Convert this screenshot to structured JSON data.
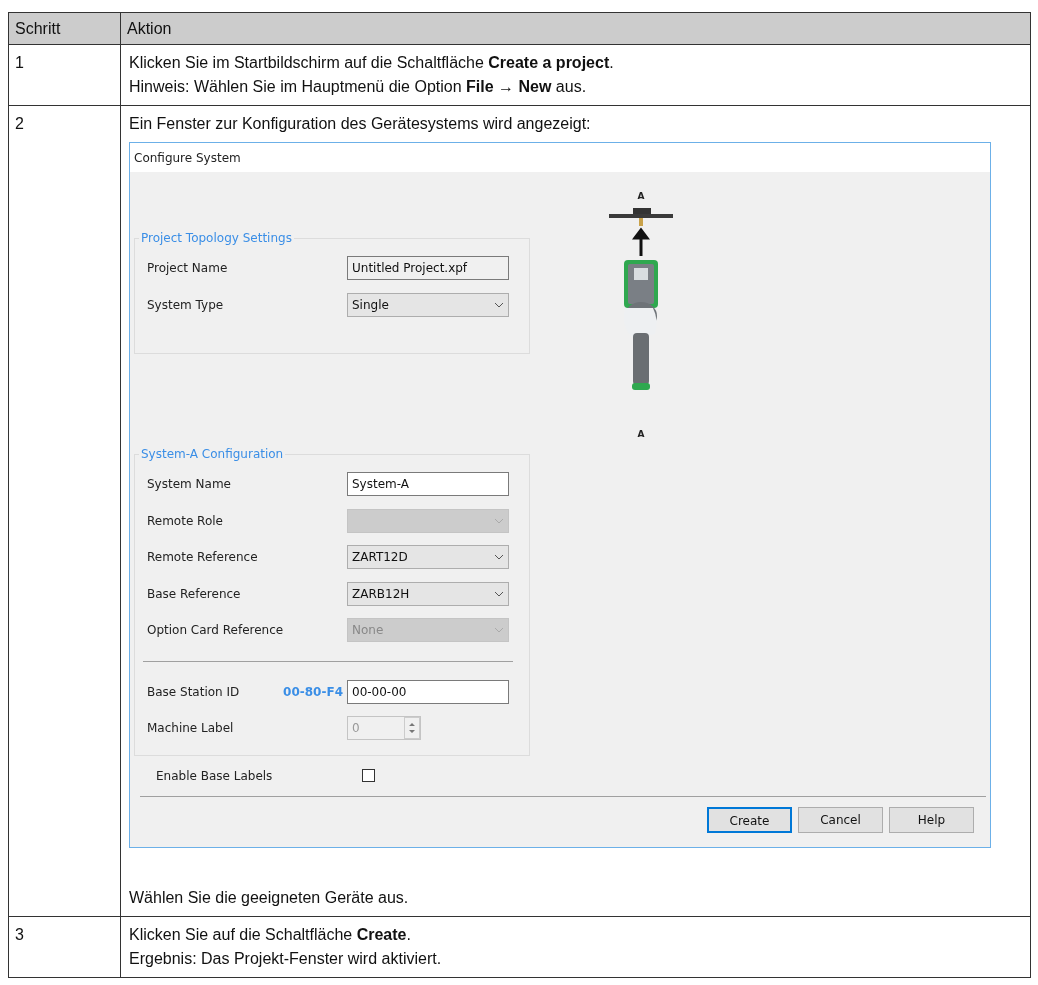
{
  "table": {
    "columns": [
      "Schritt",
      "Aktion"
    ],
    "rows": [
      {
        "step": "1",
        "lines": [
          "Klicken Sie im Startbildschirm auf die Schaltfläche **Create a project**.",
          "Hinweis: Wählen Sie im Hauptmenü die Option **File**  → **New** aus."
        ]
      },
      {
        "step": "2",
        "lines": [
          "Ein Fenster zur Konfiguration des Gerätesystems wird angezeigt:"
        ],
        "dialog": {
          "title": "Configure System",
          "groups": [
            {
              "title": "Project Topology Settings",
              "fields": [
                {
                  "kind": "text",
                  "label": "Project Name",
                  "value": "Untitled Project.xpf",
                  "disabled": false,
                  "sunken": true
                },
                {
                  "kind": "select",
                  "label": "System Type",
                  "value": "Single",
                  "disabled": false
                }
              ]
            },
            {
              "title": "System-A Configuration",
              "fields": [
                {
                  "kind": "text",
                  "label": "System Name",
                  "value": "System-A",
                  "disabled": false,
                  "sunken": false
                },
                {
                  "kind": "select",
                  "label": "Remote Role",
                  "disabled": true
                },
                {
                  "kind": "select",
                  "label": "Remote Reference",
                  "value": "ZART12D",
                  "disabled": false
                },
                {
                  "kind": "select",
                  "label": "Base Reference",
                  "value": "ZARB12H",
                  "disabled": false
                },
                {
                  "kind": "select",
                  "label": "Option Card Reference",
                  "value": "None",
                  "disabled": true
                },
                {
                  "kind": "separator"
                },
                {
                  "kind": "text",
                  "label": "Base Station ID",
                  "prefix": "00-80-F4",
                  "value": "00-00-00",
                  "disabled": false,
                  "sunken": false
                },
                {
                  "kind": "spin",
                  "label": "Machine Label",
                  "value": "0",
                  "disabled": true
                }
              ]
            }
          ],
          "checkbox": {
            "label": "Enable Base Labels",
            "checked": false
          },
          "image_labels": [
            "A",
            "A"
          ],
          "buttons": [
            {
              "label": "Create",
              "default": true
            },
            {
              "label": "Cancel",
              "default": false
            },
            {
              "label": "Help",
              "default": false
            }
          ]
        },
        "after": "Wählen Sie die geeigneten Geräte aus."
      },
      {
        "step": "3",
        "lines": [
          "Klicken Sie auf die Schaltfläche **Create**.",
          "Ergebnis: Das Projekt-Fenster wird aktiviert."
        ]
      }
    ]
  }
}
